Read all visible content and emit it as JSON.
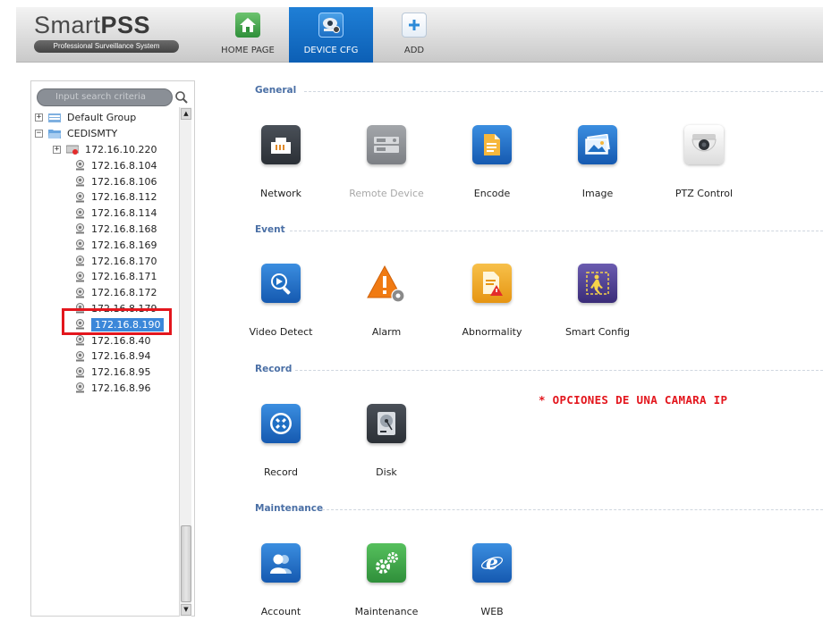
{
  "app": {
    "logo_main": "Smart",
    "logo_bold": "PSS",
    "logo_subtitle": "Professional Surveillance System"
  },
  "tabs": [
    {
      "label": "HOME PAGE",
      "icon": "home-icon",
      "color": "#3fa34d"
    },
    {
      "label": "DEVICE CFG",
      "icon": "device-config-icon",
      "color": "#1f7fd6",
      "active": true
    },
    {
      "label": "ADD",
      "icon": "plus-icon",
      "color": "#2c8ad8"
    }
  ],
  "sidebar": {
    "search_placeholder": "Input search criteria",
    "tree": [
      {
        "label": "Default Group"
      },
      {
        "label": "CEDISMTY"
      },
      {
        "label": "172.16.10.220"
      },
      {
        "label": "172.16.8.104"
      },
      {
        "label": "172.16.8.106"
      },
      {
        "label": "172.16.8.112"
      },
      {
        "label": "172.16.8.114"
      },
      {
        "label": "172.16.8.168"
      },
      {
        "label": "172.16.8.169"
      },
      {
        "label": "172.16.8.170"
      },
      {
        "label": "172.16.8.171"
      },
      {
        "label": "172.16.8.172"
      },
      {
        "label": "172.16.8.179"
      },
      {
        "label": "172.16.8.190",
        "selected": true
      },
      {
        "label": "172.16.8.40"
      },
      {
        "label": "172.16.8.94"
      },
      {
        "label": "172.16.8.95"
      },
      {
        "label": "172.16.8.96"
      }
    ]
  },
  "sections": {
    "general": {
      "title": "General",
      "items": [
        {
          "label": "Network",
          "icon": "network-icon",
          "color": "#3a3f45"
        },
        {
          "label": "Remote Device",
          "icon": "remote-device-icon",
          "color": "#8c8f93",
          "disabled": true
        },
        {
          "label": "Encode",
          "icon": "encode-icon",
          "color": "#1f6fc4"
        },
        {
          "label": "Image",
          "icon": "image-icon",
          "color": "#1f6fc4"
        },
        {
          "label": "PTZ Control",
          "icon": "ptz-camera-icon",
          "color": "#e9e9e9"
        }
      ]
    },
    "event": {
      "title": "Event",
      "items": [
        {
          "label": "Video Detect",
          "icon": "video-detect-icon",
          "color": "#1f6fc4"
        },
        {
          "label": "Alarm",
          "icon": "alarm-icon",
          "color": "#f07a12"
        },
        {
          "label": "Abnormality",
          "icon": "abnormality-icon",
          "color": "#f0a020"
        },
        {
          "label": "Smart Config",
          "icon": "smart-config-icon",
          "color": "#4a3c8c"
        }
      ]
    },
    "record": {
      "title": "Record",
      "items": [
        {
          "label": "Record",
          "icon": "record-icon",
          "color": "#1f6fc4"
        },
        {
          "label": "Disk",
          "icon": "disk-icon",
          "color": "#3a3f45"
        }
      ]
    },
    "maintenance": {
      "title": "Maintenance",
      "items": [
        {
          "label": "Account",
          "icon": "account-icon",
          "color": "#1f6fc4"
        },
        {
          "label": "Maintenance",
          "icon": "maintenance-icon",
          "color": "#3fa34d"
        },
        {
          "label": "WEB",
          "icon": "web-icon",
          "color": "#1f6fc4"
        }
      ]
    }
  },
  "annotation": "* OPCIONES DE UNA CAMARA IP"
}
